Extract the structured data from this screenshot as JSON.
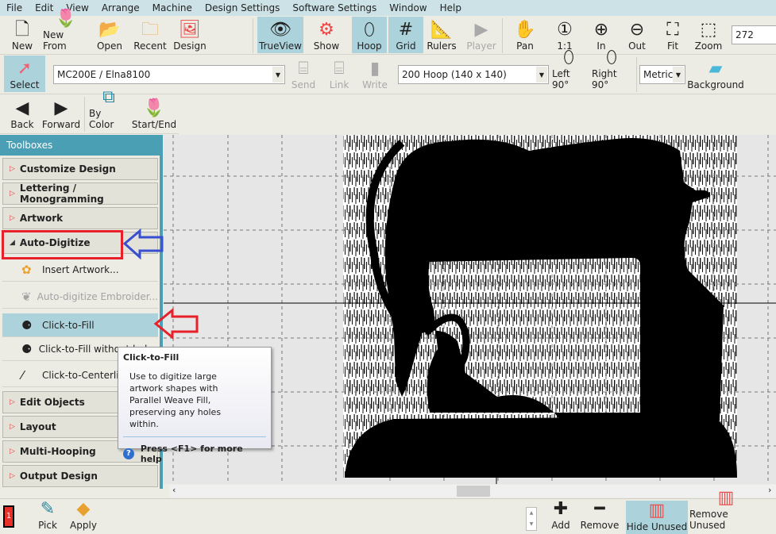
{
  "menu": [
    "File",
    "Edit",
    "View",
    "Arrange",
    "Machine",
    "Design Settings",
    "Software Settings",
    "Window",
    "Help"
  ],
  "toolbar1": {
    "new": "New",
    "new_from": "New From",
    "open": "Open",
    "recent": "Recent",
    "design": "Design",
    "trueview": "TrueView",
    "show": "Show",
    "hoop": "Hoop",
    "grid": "Grid",
    "rulers": "Rulers",
    "player": "Player",
    "pan": "Pan",
    "zoom_1_1": "1:1",
    "zoom_in": "In",
    "zoom_out": "Out",
    "fit": "Fit",
    "zoom": "Zoom",
    "zoom_value": "272"
  },
  "toolbar2": {
    "select": "Select",
    "machine": "MC200E / Elna8100",
    "send": "Send",
    "link": "Link",
    "write": "Write",
    "hoop": "200 Hoop (140 x 140)",
    "left90": "Left 90°",
    "right90": "Right 90°",
    "units": "Metric",
    "background": "Background"
  },
  "toolbar3": {
    "back": "Back",
    "forward": "Forward",
    "by_color": "By Color",
    "start_end": "Start/End"
  },
  "sidebar": {
    "title": "Toolboxes",
    "sections_top": [
      "Customize Design",
      "Lettering / Monogramming",
      "Artwork",
      "Auto-Digitize"
    ],
    "subitems": [
      "Insert Artwork...",
      "Auto-digitize Embroider...",
      "Click-to-Fill",
      "Click-to-Fill without holes",
      "Click-to-Centerline"
    ],
    "sections_bottom": [
      "Edit Objects",
      "Layout",
      "Multi-Hooping",
      "Output Design"
    ]
  },
  "tooltip": {
    "title": "Click-to-Fill",
    "body": "Use to digitize large artwork shapes with Parallel Weave Fill, preserving any holes within.",
    "help": "Press <F1> for more help"
  },
  "bottom": {
    "color_number": "1",
    "pick": "Pick",
    "apply": "Apply",
    "add": "Add",
    "remove": "Remove",
    "hide_unused": "Hide Unused",
    "remove_unused": "Remove Unused"
  },
  "colors": {
    "accent": "#4a9fb5",
    "active": "#acd3dc",
    "annotation_red": "#e8202a",
    "annotation_blue": "#3a4fd0",
    "thread_1": "#e8302a"
  }
}
